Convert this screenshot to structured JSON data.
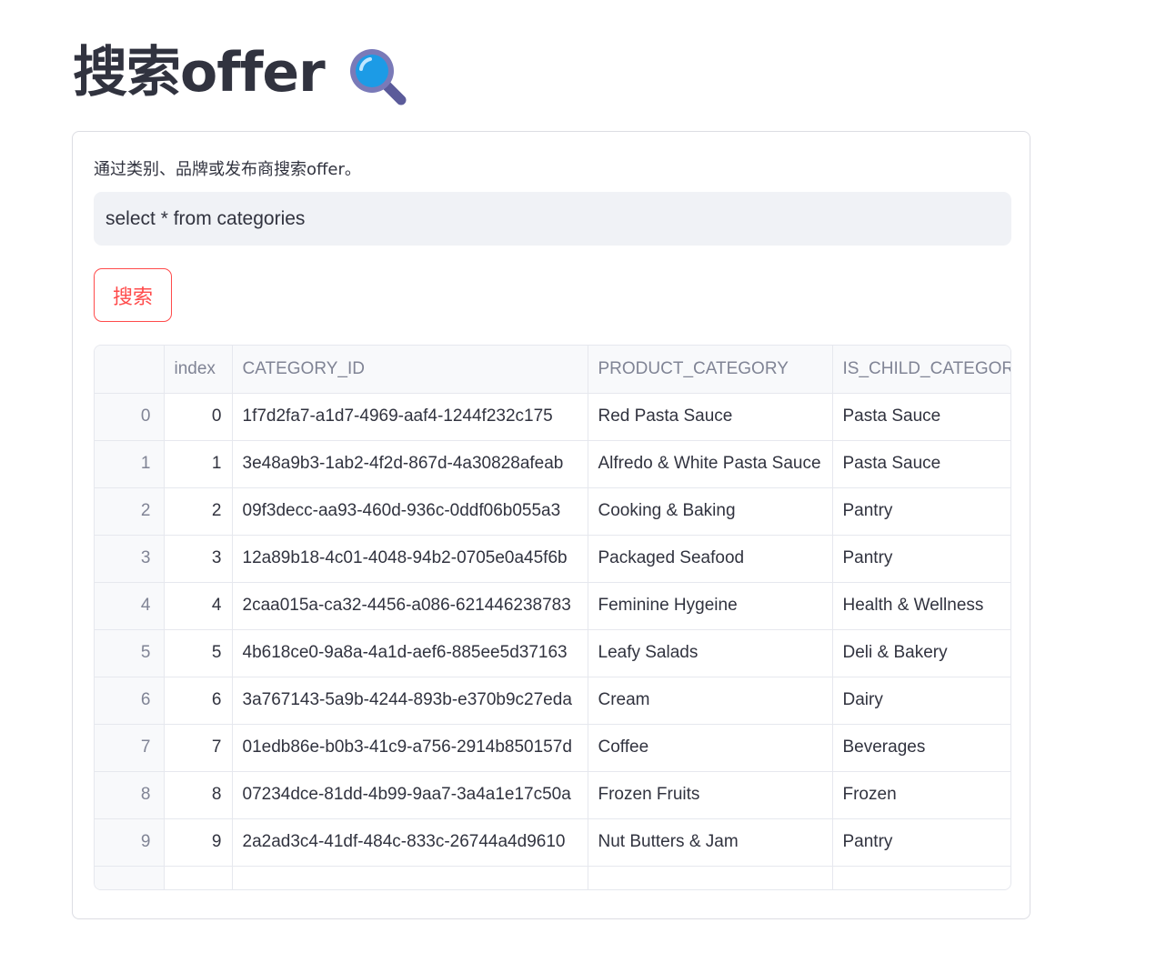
{
  "header": {
    "title": "搜索offer",
    "title_icon": "magnifying-glass-icon"
  },
  "form": {
    "label": "通过类别、品牌或发布商搜索offer。",
    "query_value": "select * from categories",
    "search_button_label": "搜索"
  },
  "table": {
    "columns": [
      "",
      "index",
      "CATEGORY_ID",
      "PRODUCT_CATEGORY",
      "IS_CHILD_CATEGORY"
    ],
    "rows": [
      {
        "rowhead": "0",
        "index": "0",
        "category_id": "1f7d2fa7-a1d7-4969-aaf4-1244f232c175",
        "product_category": "Red Pasta Sauce",
        "is_child_category": "Pasta Sauce"
      },
      {
        "rowhead": "1",
        "index": "1",
        "category_id": "3e48a9b3-1ab2-4f2d-867d-4a30828afeab",
        "product_category": "Alfredo & White Pasta Sauce",
        "is_child_category": "Pasta Sauce"
      },
      {
        "rowhead": "2",
        "index": "2",
        "category_id": "09f3decc-aa93-460d-936c-0ddf06b055a3",
        "product_category": "Cooking & Baking",
        "is_child_category": "Pantry"
      },
      {
        "rowhead": "3",
        "index": "3",
        "category_id": "12a89b18-4c01-4048-94b2-0705e0a45f6b",
        "product_category": "Packaged Seafood",
        "is_child_category": "Pantry"
      },
      {
        "rowhead": "4",
        "index": "4",
        "category_id": "2caa015a-ca32-4456-a086-621446238783",
        "product_category": "Feminine Hygeine",
        "is_child_category": "Health & Wellness"
      },
      {
        "rowhead": "5",
        "index": "5",
        "category_id": "4b618ce0-9a8a-4a1d-aef6-885ee5d37163",
        "product_category": "Leafy Salads",
        "is_child_category": "Deli & Bakery"
      },
      {
        "rowhead": "6",
        "index": "6",
        "category_id": "3a767143-5a9b-4244-893b-e370b9c27eda",
        "product_category": "Cream",
        "is_child_category": "Dairy"
      },
      {
        "rowhead": "7",
        "index": "7",
        "category_id": "01edb86e-b0b3-41c9-a756-2914b850157d",
        "product_category": "Coffee",
        "is_child_category": "Beverages"
      },
      {
        "rowhead": "8",
        "index": "8",
        "category_id": "07234dce-81dd-4b99-9aa7-3a4a1e17c50a",
        "product_category": "Frozen Fruits",
        "is_child_category": "Frozen"
      },
      {
        "rowhead": "9",
        "index": "9",
        "category_id": "2a2ad3c4-41df-484c-833c-26744a4d9610",
        "product_category": "Nut Butters & Jam",
        "is_child_category": "Pantry"
      }
    ]
  },
  "colors": {
    "accent": "#ff4b4b",
    "text": "#31333f",
    "muted": "#808495",
    "input_bg": "#f0f2f6"
  }
}
